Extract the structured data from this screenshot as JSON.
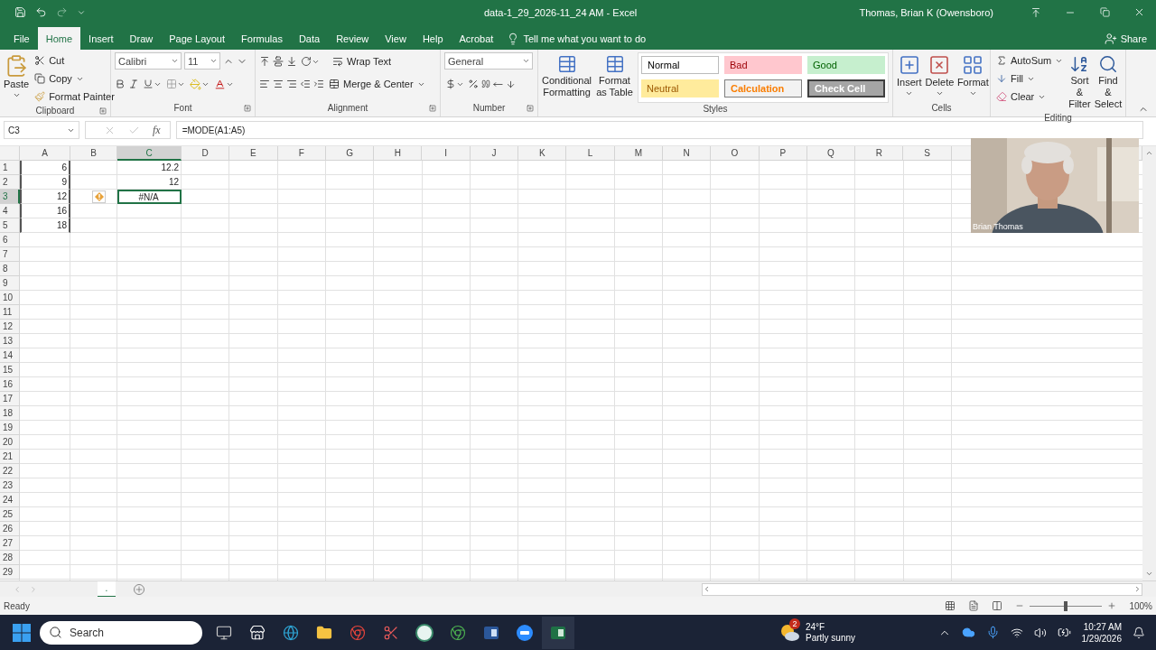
{
  "title_bar": {
    "title": "data-1_29_2026-11_24 AM  -  Excel",
    "user": "Thomas, Brian K (Owensboro)"
  },
  "menu_tabs": [
    {
      "label": "File",
      "selected": false
    },
    {
      "label": "Home",
      "selected": true
    },
    {
      "label": "Insert",
      "selected": false
    },
    {
      "label": "Draw",
      "selected": false
    },
    {
      "label": "Page Layout",
      "selected": false
    },
    {
      "label": "Formulas",
      "selected": false
    },
    {
      "label": "Data",
      "selected": false
    },
    {
      "label": "Review",
      "selected": false
    },
    {
      "label": "View",
      "selected": false
    },
    {
      "label": "Help",
      "selected": false
    },
    {
      "label": "Acrobat",
      "selected": false
    }
  ],
  "tell_me": "Tell me what you want to do",
  "share": "Share",
  "ribbon": {
    "clipboard": {
      "label": "Clipboard",
      "paste": "Paste",
      "cut": "Cut",
      "copy": "Copy",
      "format_painter": "Format Painter"
    },
    "font": {
      "label": "Font",
      "font_name": "Calibri",
      "font_size": "11"
    },
    "alignment": {
      "label": "Alignment",
      "wrap_text": "Wrap Text",
      "merge_center": "Merge & Center"
    },
    "number": {
      "label": "Number",
      "format": "General"
    },
    "styles": {
      "label": "Styles",
      "conditional_formatting": "Conditional Formatting",
      "format_as_table": "Format as Table",
      "gallery": [
        {
          "label": "Normal",
          "kind": "normal"
        },
        {
          "label": "Bad",
          "kind": "bad"
        },
        {
          "label": "Good",
          "kind": "good"
        },
        {
          "label": "Neutral",
          "kind": "neutral"
        },
        {
          "label": "Calculation",
          "kind": "calculation"
        },
        {
          "label": "Check Cell",
          "kind": "check"
        }
      ]
    },
    "cells": {
      "label": "Cells",
      "insert": "Insert",
      "delete": "Delete",
      "format": "Format"
    },
    "editing": {
      "label": "Editing",
      "autosum": "AutoSum",
      "fill": "Fill",
      "clear": "Clear",
      "sort_filter": "Sort & Filter",
      "find_select": "Find & Select"
    }
  },
  "formula_bar": {
    "name_box": "C3",
    "function_label": "fx",
    "formula": "=MODE(A1:A5)"
  },
  "sheet": {
    "columns": [
      {
        "label": "A",
        "selected": false
      },
      {
        "label": "B",
        "selected": false
      },
      {
        "label": "C",
        "selected": true
      },
      {
        "label": "D",
        "selected": false
      },
      {
        "label": "E",
        "selected": false
      },
      {
        "label": "F",
        "selected": false
      },
      {
        "label": "G",
        "selected": false
      },
      {
        "label": "H",
        "selected": false
      },
      {
        "label": "I",
        "selected": false
      },
      {
        "label": "J",
        "selected": false
      },
      {
        "label": "K",
        "selected": false
      },
      {
        "label": "L",
        "selected": false
      },
      {
        "label": "M",
        "selected": false
      },
      {
        "label": "N",
        "selected": false
      },
      {
        "label": "O",
        "selected": false
      },
      {
        "label": "P",
        "selected": false
      },
      {
        "label": "Q",
        "selected": false
      },
      {
        "label": "R",
        "selected": false
      },
      {
        "label": "S",
        "selected": false
      }
    ],
    "rows": [
      {
        "header": "1",
        "selected": false,
        "a": "6",
        "c": "12.2"
      },
      {
        "header": "2",
        "selected": false,
        "a": "9",
        "c": "12"
      },
      {
        "header": "3",
        "selected": true,
        "error_flag": true,
        "a": "12",
        "c": "#N/A"
      },
      {
        "header": "4",
        "selected": false,
        "a": "16"
      },
      {
        "header": "5",
        "selected": false,
        "a": "18"
      },
      {
        "header": "6",
        "selected": false
      },
      {
        "header": "7",
        "selected": false
      },
      {
        "header": "8",
        "selected": false
      },
      {
        "header": "9",
        "selected": false
      },
      {
        "header": "10",
        "selected": false
      },
      {
        "header": "11",
        "selected": false
      },
      {
        "header": "12",
        "selected": false
      },
      {
        "header": "13",
        "selected": false
      },
      {
        "header": "14",
        "selected": false
      },
      {
        "header": "15",
        "selected": false
      },
      {
        "header": "16",
        "selected": false
      },
      {
        "header": "17",
        "selected": false
      },
      {
        "header": "18",
        "selected": false
      },
      {
        "header": "19",
        "selected": false
      },
      {
        "header": "20",
        "selected": false
      },
      {
        "header": "21",
        "selected": false
      },
      {
        "header": "22",
        "selected": false
      },
      {
        "header": "23",
        "selected": false
      },
      {
        "header": "24",
        "selected": false
      },
      {
        "header": "25",
        "selected": false
      },
      {
        "header": "26",
        "selected": false
      },
      {
        "header": "27",
        "selected": false
      },
      {
        "header": "28",
        "selected": false
      },
      {
        "header": "29",
        "selected": false
      }
    ]
  },
  "video": {
    "kind": "picture",
    "name": "Brian Thomas"
  },
  "sheet_tabs": [
    {
      "label": ".",
      "selected": true
    }
  ],
  "status_bar": {
    "status": "Ready",
    "zoom": "100%",
    "zoom_level": {
      "level": 0.5
    }
  },
  "taskbar": {
    "search_placeholder": "Search",
    "weather": {
      "badge": "2",
      "temperature": "24°F",
      "condition": "Partly sunny"
    },
    "time": "10:27 AM",
    "date": "1/29/2026"
  }
}
